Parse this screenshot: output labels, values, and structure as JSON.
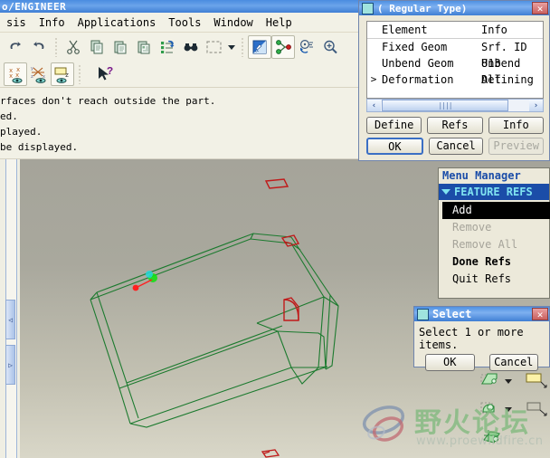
{
  "app": {
    "title": "o/ENGINEER",
    "menu": [
      {
        "label": "sis"
      },
      {
        "label": "Info"
      },
      {
        "label": "Applications"
      },
      {
        "label": "Tools"
      },
      {
        "label": "Window"
      },
      {
        "label": "Help"
      }
    ]
  },
  "toolbar1": [
    {
      "name": "undo-icon",
      "label": "Undo"
    },
    {
      "name": "redo-icon",
      "label": "Redo"
    },
    {
      "name": "cut-icon",
      "label": "Cut"
    },
    {
      "name": "copy-icon",
      "label": "Copy"
    },
    {
      "name": "paste-icon",
      "label": "Paste"
    },
    {
      "name": "paste-special-icon",
      "label": "Paste Special"
    },
    {
      "name": "regenerate-icon",
      "label": "Regenerate"
    },
    {
      "name": "find-icon",
      "label": "Find"
    },
    {
      "name": "selection-box-icon",
      "label": "Selection Filter"
    },
    {
      "name": "repaint-icon",
      "label": "Repaint"
    },
    {
      "name": "datum-display-icon",
      "label": "Datum Display"
    },
    {
      "name": "spin-center-icon",
      "label": "Spin Center"
    },
    {
      "name": "zoom-in-icon",
      "label": "Zoom In"
    }
  ],
  "toolbar2": [
    {
      "name": "datum-point-display-icon",
      "label": "Datum Point Display"
    },
    {
      "name": "datum-axis-display-icon",
      "label": "Datum Axis Display"
    },
    {
      "name": "datum-plane-display-icon",
      "label": "Datum Plane Display"
    },
    {
      "name": "context-help-icon",
      "label": "Context Sensitive Help"
    }
  ],
  "messages": [
    "rfaces don't reach outside the part.",
    "ed.",
    "played.",
    "be displayed."
  ],
  "feature_dialog": {
    "title": "( Regular Type)",
    "close_label": "✕",
    "columns": [
      "Element",
      "Info"
    ],
    "rows": [
      {
        "mark": "",
        "element": "Fixed Geom",
        "info": "Srf. ID 813"
      },
      {
        "mark": "",
        "element": "Unbend Geom",
        "info": "Unbend All"
      },
      {
        "mark": ">",
        "element": "Deformation",
        "info": "Defining"
      }
    ],
    "scroll_left": "‹",
    "scroll_right": "›",
    "buttons_row1": [
      {
        "label": "Define",
        "state": "normal"
      },
      {
        "label": "Refs",
        "state": "normal"
      },
      {
        "label": "Info",
        "state": "normal"
      }
    ],
    "buttons_row2": [
      {
        "label": "OK",
        "state": "default"
      },
      {
        "label": "Cancel",
        "state": "normal"
      },
      {
        "label": "Preview",
        "state": "disabled"
      }
    ]
  },
  "menu_manager": {
    "title": "Menu Manager",
    "header": "FEATURE REFS",
    "items": [
      {
        "label": "Add",
        "state": "selected"
      },
      {
        "label": "Remove",
        "state": "disabled"
      },
      {
        "label": "Remove All",
        "state": "disabled"
      },
      {
        "label": "Done Refs",
        "state": "bold"
      },
      {
        "label": "Quit Refs",
        "state": "normal"
      }
    ]
  },
  "select_dialog": {
    "title": "Select",
    "close_label": "✕",
    "message": "Select 1 or more items.",
    "ok_label": "OK",
    "cancel_label": "Cancel"
  },
  "right_tools": [
    {
      "name": "flat-wall-icon",
      "label": "Flat Wall"
    },
    {
      "name": "flange-wall-icon",
      "label": "Flange Wall"
    },
    {
      "name": "unbend-icon",
      "label": "Unbend"
    },
    {
      "name": "bend-back-icon",
      "label": "Bend Back"
    },
    {
      "name": "deform-area-icon",
      "label": "Deform Area"
    }
  ],
  "viewport": {
    "model_color": "#1b7a2e",
    "highlight_color": "#c01a1a",
    "background_top": "#a5a49a",
    "background_bottom": "#d9d7c8",
    "csys": {
      "x_color": "#ff2020",
      "y_color": "#15e015",
      "z_color": "#22d8d8"
    }
  },
  "watermark": {
    "text_cn": "野火论坛",
    "url": "www.proewildfire.cn"
  },
  "colors": {
    "titlebar_blue": "#4a8ce0",
    "menu_selected": "#000000",
    "menu_header_bg": "#1b4da8",
    "menu_header_fg": "#7fe3f0",
    "dialog_bg": "#ece9da"
  }
}
